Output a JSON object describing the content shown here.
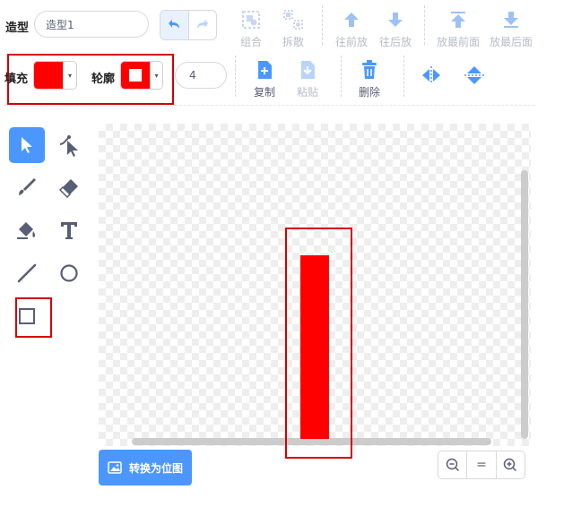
{
  "costume": {
    "label": "造型",
    "name_value": "造型1"
  },
  "arrange": {
    "group": "组合",
    "ungroup": "拆散",
    "forward": "往前放",
    "backward": "往后放",
    "front": "放最前面",
    "back": "放最后面"
  },
  "style": {
    "fill_label": "填充",
    "fill_color": "#ff0000",
    "outline_label": "轮廓",
    "outline_color": "#ff0000",
    "outline_width": "4"
  },
  "edit": {
    "copy": "复制",
    "paste": "粘贴",
    "delete": "删除"
  },
  "canvas": {
    "convert_bitmap": "转换为位图",
    "zoom_reset": "="
  },
  "colors": {
    "accent": "#4c97ff",
    "highlight": "#d40000",
    "shape_fill": "#ff0000"
  }
}
